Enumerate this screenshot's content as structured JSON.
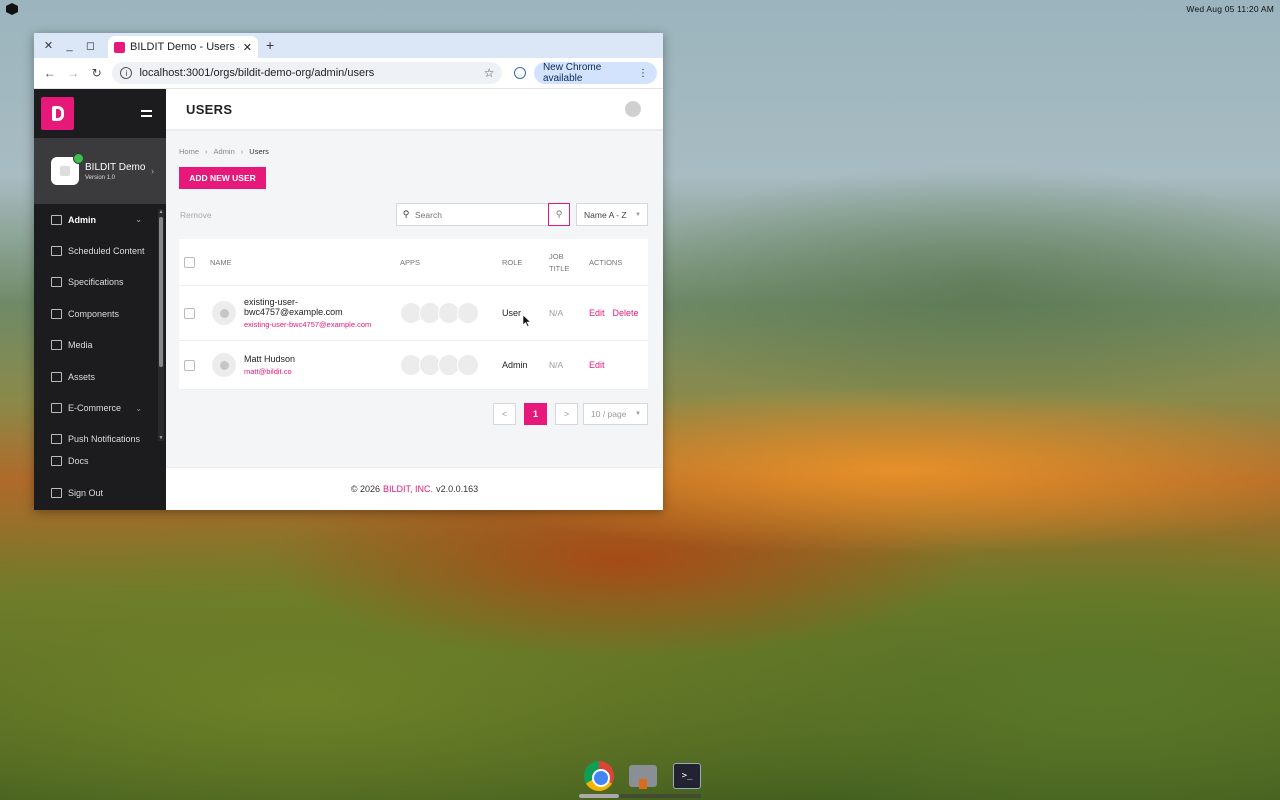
{
  "system": {
    "clock": "Wed Aug 05   11:20 AM"
  },
  "browser": {
    "tab_title": "BILDIT Demo - Users -",
    "url": "localhost:3001/orgs/bildit-demo-org/admin/users",
    "update_label": "New Chrome available"
  },
  "sidebar": {
    "org_name": "BILDIT Demo",
    "org_version": "Version 1.0",
    "items": [
      {
        "label": "Admin",
        "icon": "admin-users-icon"
      },
      {
        "label": "Scheduled Content",
        "icon": "calendar-icon"
      },
      {
        "label": "Specifications",
        "icon": "specifications-icon"
      },
      {
        "label": "Components",
        "icon": "components-icon"
      },
      {
        "label": "Media",
        "icon": "image-icon"
      },
      {
        "label": "Assets",
        "icon": "assets-icon"
      },
      {
        "label": "E-Commerce",
        "icon": "store-icon"
      },
      {
        "label": "Push Notifications",
        "icon": "notification-icon"
      }
    ],
    "bottom_items": [
      {
        "label": "Docs",
        "icon": "docs-icon"
      },
      {
        "label": "Sign Out",
        "icon": "sign-out-icon"
      }
    ]
  },
  "page": {
    "title": "USERS",
    "breadcrumb": [
      "Home",
      "Admin",
      "Users"
    ],
    "add_button": "ADD NEW USER",
    "remove_label": "Remove",
    "search_placeholder": "Search",
    "sort_value": "Name A - Z"
  },
  "table": {
    "headers": {
      "name": "NAME",
      "apps": "APPS",
      "role": "ROLE",
      "job_title": "JOB TITLE",
      "actions": "ACTIONS"
    },
    "rows": [
      {
        "name": "existing-user-bwc4757@example.com",
        "name_line1": "existing-user-",
        "name_line2": "bwc4757@example.com",
        "email": "existing-user-bwc4757@example.com",
        "role": "User",
        "job_title": "N/A",
        "actions": [
          "Edit",
          "Delete"
        ]
      },
      {
        "name": "Matt Hudson",
        "email": "matt@bildit.co",
        "role": "Admin",
        "job_title": "N/A",
        "actions": [
          "Edit"
        ]
      }
    ]
  },
  "pagination": {
    "prev": "<",
    "current": "1",
    "next": ">",
    "per_page": "10 / page"
  },
  "footer": {
    "prefix": "© 2026",
    "company": "BILDIT, INC.",
    "version": "v2.0.0.163"
  },
  "colors": {
    "accent": "#e6197a",
    "sidebar_bg": "#1c1c1e"
  }
}
